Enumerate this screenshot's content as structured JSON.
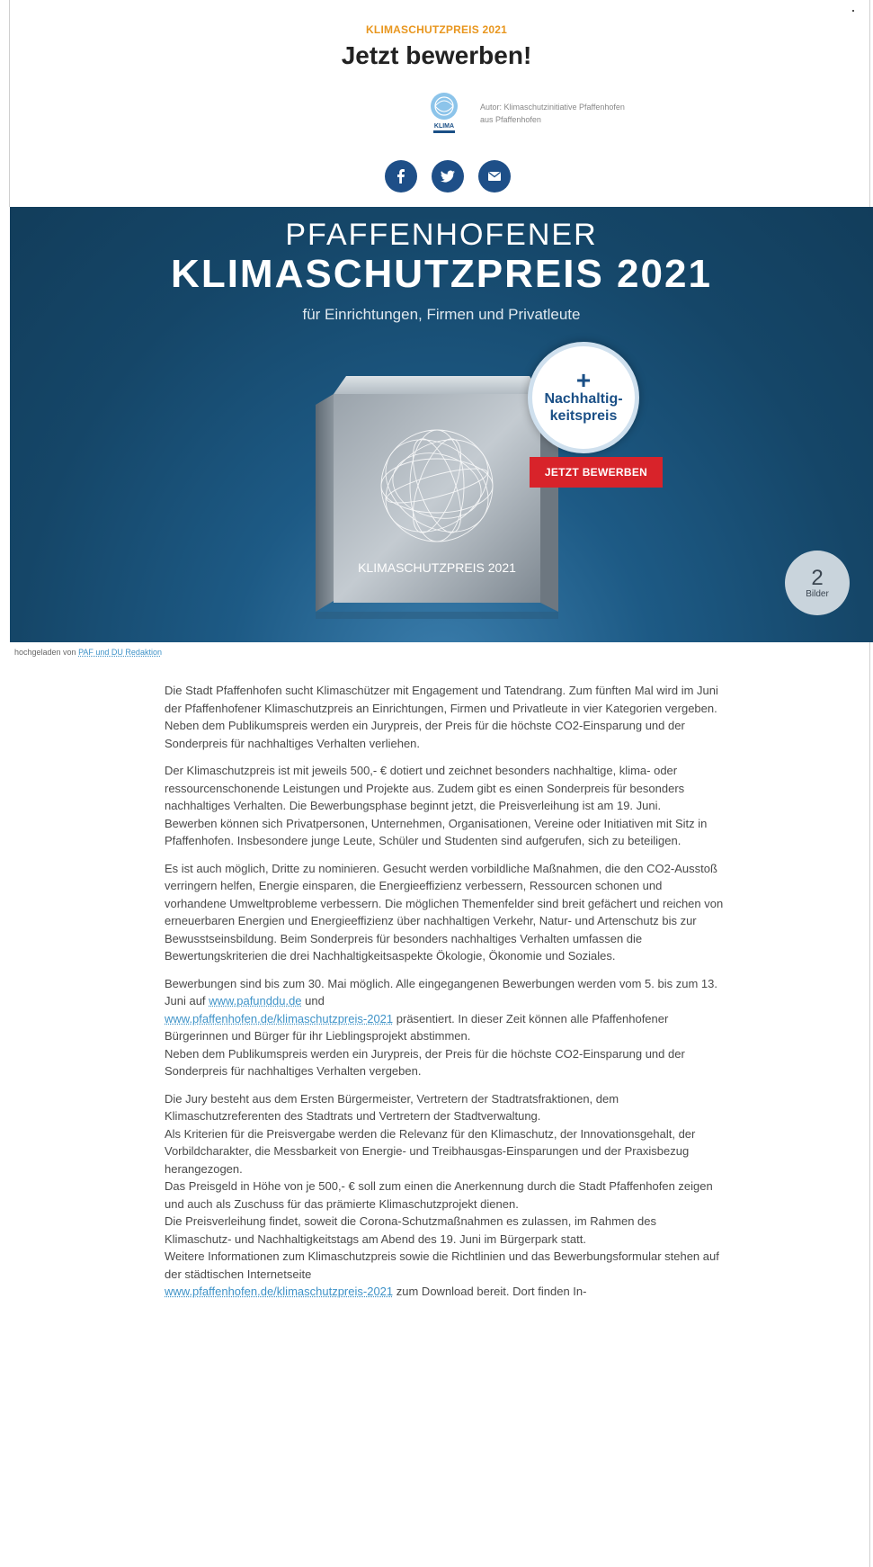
{
  "article": {
    "kicker": "KLIMASCHUTZPREIS 2021",
    "headline": "Jetzt bewerben!",
    "author_line1": "Autor: Klimaschutzinitiative Pfaffenhofen",
    "author_line2": "aus Pfaffenhofen",
    "author_logo_text": "KLIMA",
    "share_icons": [
      "facebook-icon",
      "twitter-icon",
      "email-icon"
    ]
  },
  "hero": {
    "title1": "PFAFFENHOFENER",
    "title2": "KLIMASCHUTZPREIS 2021",
    "subtitle": "für Einrichtungen, Firmen und Privatleute",
    "badge_plus": "+",
    "badge_line1": "Nachhaltig-",
    "badge_line2": "keitspreis",
    "cta": "JETZT BEWERBEN",
    "cube_label": "KLIMASCHUTZPREIS 2021",
    "image_count": "2",
    "image_count_label": "Bilder"
  },
  "credit": {
    "prefix": "hochgeladen von",
    "link": "PAF und DU Redaktion"
  },
  "body": {
    "p1": "Die Stadt Pfaffenhofen sucht Klimaschützer mit Engagement und Tatendrang. Zum fünften Mal wird im Juni der Pfaffenhofener Klimaschutzpreis an Einrichtungen, Firmen und Privatleute in vier Kategorien vergeben. Neben dem Publikumspreis werden ein Jurypreis, der Preis für die höchste CO2-Einsparung und der Sonderpreis für nachhaltiges Verhalten verliehen.",
    "p2": "Der Klimaschutzpreis ist mit jeweils 500,- € dotiert und zeichnet besonders nachhaltige, klima- oder ressourcenschonende Leistungen und Projekte aus. Zudem gibt es einen Sonderpreis für besonders nachhaltiges Verhalten. Die Bewerbungsphase beginnt jetzt, die Preisverleihung ist am 19. Juni.",
    "p2b": "Bewerben können sich Privatpersonen, Unternehmen, Organisationen, Vereine oder Initiativen mit Sitz in Pfaffenhofen. Insbesondere junge Leute, Schüler und Studenten sind aufgerufen, sich zu beteiligen.",
    "p3": "Es ist auch möglich, Dritte zu nominieren. Gesucht werden vorbildliche Maßnahmen, die den CO2-Ausstoß verringern helfen, Energie einsparen, die Energieeffizienz verbessern, Ressourcen schonen und vorhandene Umweltprobleme verbessern. Die möglichen Themenfelder sind breit gefächert und reichen von erneuerbaren Energien und Energieeffizienz über nachhaltigen Verkehr, Natur- und Artenschutz bis zur Bewusstseinsbildung. Beim Sonderpreis für besonders nachhaltiges Verhalten umfassen die Bewertungskriterien die drei Nachhaltigkeitsaspekte Ökologie, Ökonomie und Soziales.",
    "p4a": "Bewerbungen sind bis zum 30. Mai möglich. Alle eingegangenen Bewerbungen werden vom 5. bis zum 13. Juni auf",
    "p4_link1": "www.pafunddu.de",
    "p4b": "und",
    "p4_link2": "www.pfaffenhofen.de/klimaschutzpreis-2021",
    "p4c": "präsentiert. In dieser Zeit können alle Pfaffenhofener Bürgerinnen und Bürger für ihr Lieblingsprojekt abstimmen.",
    "p4d": "Neben dem Publikumspreis werden ein Jurypreis, der Preis für die höchste CO2-Einsparung und der Sonderpreis für nachhaltiges Verhalten vergeben.",
    "p5a": "Die Jury besteht aus dem Ersten Bürgermeister, Vertretern der Stadtratsfraktionen, dem Klimaschutzreferenten des Stadtrats und Vertretern der Stadtverwaltung.",
    "p5b": "Als Kriterien für die Preisvergabe werden die Relevanz für den Klimaschutz, der Innovationsgehalt, der Vorbildcharakter, die Messbarkeit von Energie- und Treibhausgas-Einsparungen und der Praxisbezug herangezogen.",
    "p5c": "Das Preisgeld in Höhe von je 500,- € soll zum einen die Anerkennung durch die Stadt Pfaffenhofen zeigen und auch als Zuschuss für das prämierte Klimaschutzprojekt dienen.",
    "p5d": "Die Preisverleihung findet, soweit die Corona-Schutzmaßnahmen es zulassen, im Rahmen des Klimaschutz- und Nachhaltigkeitstags am Abend des 19. Juni im Bürgerpark statt.",
    "p5e": "Weitere Informationen zum Klimaschutzpreis sowie die Richtlinien und das Bewerbungsformular stehen auf der städtischen Internetseite",
    "p5_link": "www.pfaffenhofen.de/klimaschutzpreis-2021",
    "p5f": "zum Download bereit. Dort finden In-"
  },
  "colors": {
    "kicker": "#e8961e",
    "share": "#1e4f88",
    "hero_bg": "#154668",
    "cta": "#d8232a",
    "link": "#3f93c8"
  }
}
